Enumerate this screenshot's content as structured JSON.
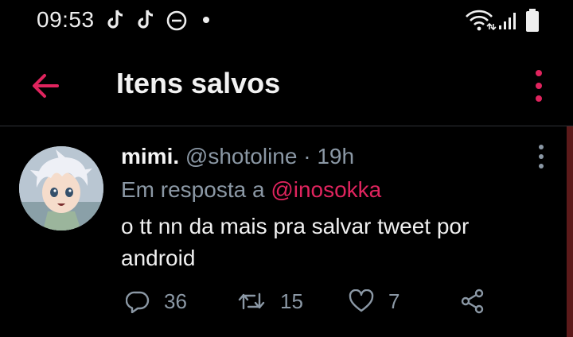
{
  "status_bar": {
    "time": "09:53",
    "icons": [
      "tiktok-icon",
      "tiktok-icon",
      "do-not-disturb-icon",
      "dot-icon",
      "wifi-icon",
      "signal-icon",
      "battery-icon"
    ]
  },
  "app_bar": {
    "title": "Itens salvos",
    "back_icon": "arrow-left-icon",
    "menu_icon": "more-vertical-icon",
    "accent_color": "#e0245e"
  },
  "tweet": {
    "display_name": "mimi.",
    "handle": "@shotoline",
    "separator": "·",
    "time": "19h",
    "reply_prefix": "Em resposta a",
    "reply_to": "@inosokka",
    "text": "o tt nn da mais pra salvar tweet por android",
    "actions": {
      "reply_count": "36",
      "retweet_count": "15",
      "like_count": "7"
    }
  },
  "colors": {
    "background": "#000000",
    "secondary_text": "#8b98a5",
    "accent": "#e0245e"
  }
}
